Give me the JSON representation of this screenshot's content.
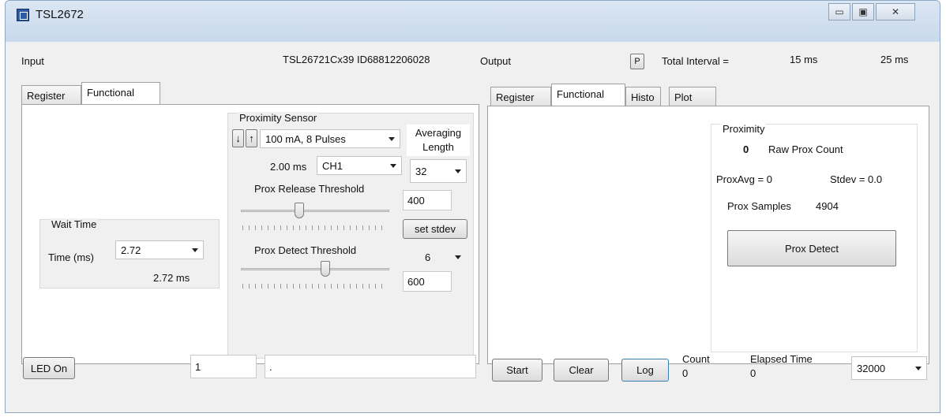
{
  "window": {
    "title": "TSL2672"
  },
  "header": {
    "input_label": "Input",
    "device_id": "TSL26721Cx39 ID68812206028",
    "output_label": "Output",
    "p_button": "P",
    "total_interval_label": "Total Interval =",
    "interval_1": "15 ms",
    "interval_2": "25 ms"
  },
  "input_tabs": [
    "Register",
    "Functional"
  ],
  "wait_time": {
    "title": "Wait Time",
    "time_label": "Time (ms)",
    "time_value": "2.72",
    "time_readout": "2.72 ms"
  },
  "prox_sensor": {
    "title": "Proximity Sensor",
    "down_arrow": "↓",
    "up_arrow": "↑",
    "led_drive": "100 mA, 8 Pulses",
    "averaging_label_1": "Averaging",
    "averaging_label_2": "Length",
    "integration_time": "2.00 ms",
    "channel": "CH1",
    "averaging_value": "32",
    "release_label": "Prox Release Threshold",
    "release_value": "400",
    "set_stdev_button": "set stdev",
    "stdev_value": "6",
    "detect_label": "Prox Detect Threshold",
    "detect_value": "600"
  },
  "output_tabs": [
    "Register",
    "Functional",
    "Histo",
    "Plot"
  ],
  "proximity": {
    "title": "Proximity",
    "raw_value": "0",
    "raw_label": "Raw Prox Count",
    "prox_avg": "ProxAvg = 0",
    "stdev": "Stdev = 0.0",
    "samples_label": "Prox Samples",
    "samples_value": "4904",
    "detect_button": "Prox Detect"
  },
  "footer": {
    "led_on_button": "LED On",
    "field_1": "1",
    "field_2": ".",
    "start_button": "Start",
    "clear_button": "Clear",
    "log_button": "Log",
    "count_label": "Count",
    "count_value": "0",
    "elapsed_label": "Elapsed Time",
    "elapsed_value": "0",
    "rate_value": "32000"
  },
  "icons": {
    "app": "app-icon",
    "minimize": "minimize-icon",
    "maximize": "maximize-icon",
    "close": "close-icon"
  }
}
